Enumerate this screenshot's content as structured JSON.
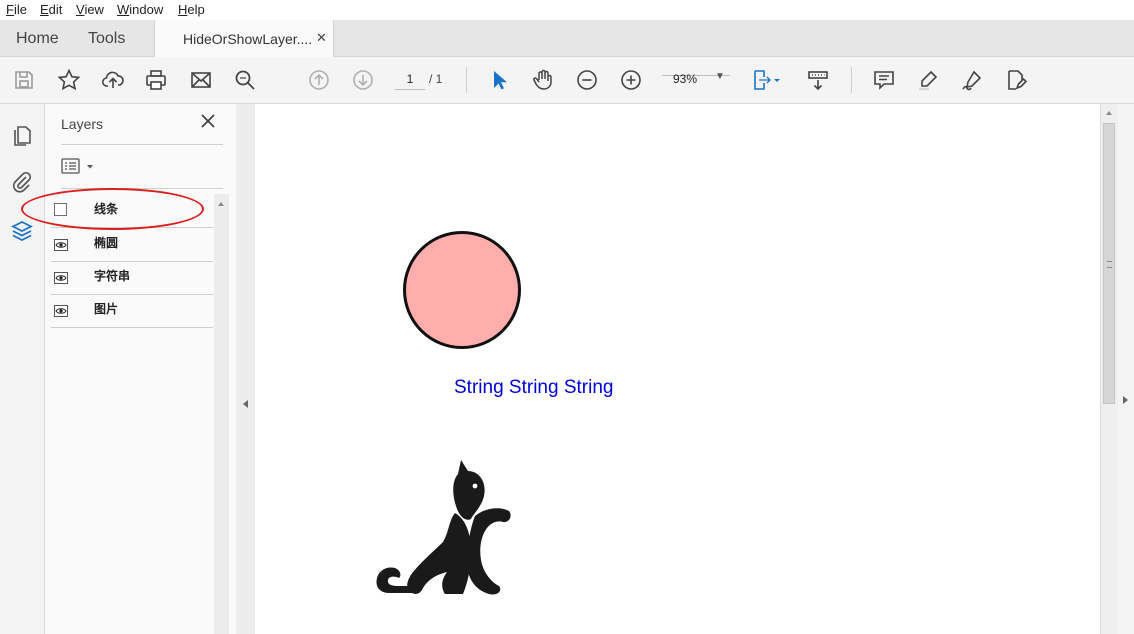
{
  "menu": [
    {
      "id": "file",
      "accel": "F",
      "rest": "ile"
    },
    {
      "id": "edit",
      "accel": "E",
      "rest": "dit"
    },
    {
      "id": "view",
      "accel": "V",
      "rest": "iew"
    },
    {
      "id": "window",
      "accel": "W",
      "rest": "indow"
    },
    {
      "id": "help",
      "accel": "H",
      "rest": "elp"
    }
  ],
  "tabs": {
    "home": "Home",
    "tools": "Tools",
    "document": "HideOrShowLayer....",
    "close_glyph": "✕"
  },
  "toolbar": {
    "page_current": "1",
    "page_total": "/ 1",
    "zoom": "93%",
    "zoom_caret": "▼",
    "icons": [
      "save-icon",
      "bookmark-star-icon",
      "upload-icon",
      "print-icon",
      "email-icon",
      "search-icon",
      "page-up-icon",
      "page-down-icon",
      "select-cursor-icon",
      "hand-tool-icon",
      "zoom-out-icon",
      "zoom-in-icon",
      "page-fit-icon",
      "scroll-mode-icon",
      "comment-icon",
      "highlight-icon",
      "sign-icon",
      "fill-sign-icon"
    ]
  },
  "layers_panel": {
    "title": "Layers",
    "close_glyph": "✕",
    "layers": [
      {
        "name": "线条",
        "visible": false
      },
      {
        "name": "椭圆",
        "visible": true
      },
      {
        "name": "字符串",
        "visible": true
      },
      {
        "name": "图片",
        "visible": true
      }
    ]
  },
  "document": {
    "text": "String String String"
  },
  "colors": {
    "circle_fill": "#ffadad",
    "text": "#0000d8",
    "accent_blue": "#1a73c8",
    "annotation_red": "#d9201f"
  }
}
